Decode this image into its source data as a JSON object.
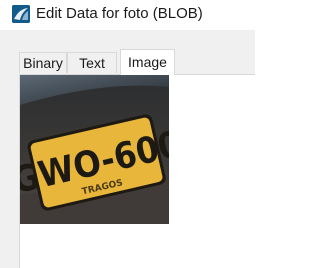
{
  "window": {
    "title": "Edit Data for foto (BLOB)",
    "icon": "mysql-workbench-icon"
  },
  "tabs": [
    {
      "label": "Binary",
      "active": false
    },
    {
      "label": "Text",
      "active": false
    },
    {
      "label": "Image",
      "active": true
    }
  ],
  "image": {
    "plate_text": "GWO-600",
    "plate_subtext": "TRAGOS",
    "plate_color": "#e8b63a"
  }
}
